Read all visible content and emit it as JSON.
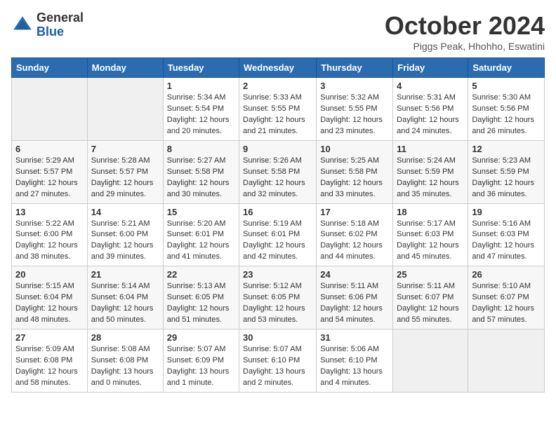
{
  "header": {
    "logo_general": "General",
    "logo_blue": "Blue",
    "month_title": "October 2024",
    "location": "Piggs Peak, Hhohho, Eswatini"
  },
  "weekdays": [
    "Sunday",
    "Monday",
    "Tuesday",
    "Wednesday",
    "Thursday",
    "Friday",
    "Saturday"
  ],
  "weeks": [
    [
      {
        "day": "",
        "sunrise": "",
        "sunset": "",
        "daylight": ""
      },
      {
        "day": "",
        "sunrise": "",
        "sunset": "",
        "daylight": ""
      },
      {
        "day": "1",
        "sunrise": "Sunrise: 5:34 AM",
        "sunset": "Sunset: 5:54 PM",
        "daylight": "Daylight: 12 hours and 20 minutes."
      },
      {
        "day": "2",
        "sunrise": "Sunrise: 5:33 AM",
        "sunset": "Sunset: 5:55 PM",
        "daylight": "Daylight: 12 hours and 21 minutes."
      },
      {
        "day": "3",
        "sunrise": "Sunrise: 5:32 AM",
        "sunset": "Sunset: 5:55 PM",
        "daylight": "Daylight: 12 hours and 23 minutes."
      },
      {
        "day": "4",
        "sunrise": "Sunrise: 5:31 AM",
        "sunset": "Sunset: 5:56 PM",
        "daylight": "Daylight: 12 hours and 24 minutes."
      },
      {
        "day": "5",
        "sunrise": "Sunrise: 5:30 AM",
        "sunset": "Sunset: 5:56 PM",
        "daylight": "Daylight: 12 hours and 26 minutes."
      }
    ],
    [
      {
        "day": "6",
        "sunrise": "Sunrise: 5:29 AM",
        "sunset": "Sunset: 5:57 PM",
        "daylight": "Daylight: 12 hours and 27 minutes."
      },
      {
        "day": "7",
        "sunrise": "Sunrise: 5:28 AM",
        "sunset": "Sunset: 5:57 PM",
        "daylight": "Daylight: 12 hours and 29 minutes."
      },
      {
        "day": "8",
        "sunrise": "Sunrise: 5:27 AM",
        "sunset": "Sunset: 5:58 PM",
        "daylight": "Daylight: 12 hours and 30 minutes."
      },
      {
        "day": "9",
        "sunrise": "Sunrise: 5:26 AM",
        "sunset": "Sunset: 5:58 PM",
        "daylight": "Daylight: 12 hours and 32 minutes."
      },
      {
        "day": "10",
        "sunrise": "Sunrise: 5:25 AM",
        "sunset": "Sunset: 5:58 PM",
        "daylight": "Daylight: 12 hours and 33 minutes."
      },
      {
        "day": "11",
        "sunrise": "Sunrise: 5:24 AM",
        "sunset": "Sunset: 5:59 PM",
        "daylight": "Daylight: 12 hours and 35 minutes."
      },
      {
        "day": "12",
        "sunrise": "Sunrise: 5:23 AM",
        "sunset": "Sunset: 5:59 PM",
        "daylight": "Daylight: 12 hours and 36 minutes."
      }
    ],
    [
      {
        "day": "13",
        "sunrise": "Sunrise: 5:22 AM",
        "sunset": "Sunset: 6:00 PM",
        "daylight": "Daylight: 12 hours and 38 minutes."
      },
      {
        "day": "14",
        "sunrise": "Sunrise: 5:21 AM",
        "sunset": "Sunset: 6:00 PM",
        "daylight": "Daylight: 12 hours and 39 minutes."
      },
      {
        "day": "15",
        "sunrise": "Sunrise: 5:20 AM",
        "sunset": "Sunset: 6:01 PM",
        "daylight": "Daylight: 12 hours and 41 minutes."
      },
      {
        "day": "16",
        "sunrise": "Sunrise: 5:19 AM",
        "sunset": "Sunset: 6:01 PM",
        "daylight": "Daylight: 12 hours and 42 minutes."
      },
      {
        "day": "17",
        "sunrise": "Sunrise: 5:18 AM",
        "sunset": "Sunset: 6:02 PM",
        "daylight": "Daylight: 12 hours and 44 minutes."
      },
      {
        "day": "18",
        "sunrise": "Sunrise: 5:17 AM",
        "sunset": "Sunset: 6:03 PM",
        "daylight": "Daylight: 12 hours and 45 minutes."
      },
      {
        "day": "19",
        "sunrise": "Sunrise: 5:16 AM",
        "sunset": "Sunset: 6:03 PM",
        "daylight": "Daylight: 12 hours and 47 minutes."
      }
    ],
    [
      {
        "day": "20",
        "sunrise": "Sunrise: 5:15 AM",
        "sunset": "Sunset: 6:04 PM",
        "daylight": "Daylight: 12 hours and 48 minutes."
      },
      {
        "day": "21",
        "sunrise": "Sunrise: 5:14 AM",
        "sunset": "Sunset: 6:04 PM",
        "daylight": "Daylight: 12 hours and 50 minutes."
      },
      {
        "day": "22",
        "sunrise": "Sunrise: 5:13 AM",
        "sunset": "Sunset: 6:05 PM",
        "daylight": "Daylight: 12 hours and 51 minutes."
      },
      {
        "day": "23",
        "sunrise": "Sunrise: 5:12 AM",
        "sunset": "Sunset: 6:05 PM",
        "daylight": "Daylight: 12 hours and 53 minutes."
      },
      {
        "day": "24",
        "sunrise": "Sunrise: 5:11 AM",
        "sunset": "Sunset: 6:06 PM",
        "daylight": "Daylight: 12 hours and 54 minutes."
      },
      {
        "day": "25",
        "sunrise": "Sunrise: 5:11 AM",
        "sunset": "Sunset: 6:07 PM",
        "daylight": "Daylight: 12 hours and 55 minutes."
      },
      {
        "day": "26",
        "sunrise": "Sunrise: 5:10 AM",
        "sunset": "Sunset: 6:07 PM",
        "daylight": "Daylight: 12 hours and 57 minutes."
      }
    ],
    [
      {
        "day": "27",
        "sunrise": "Sunrise: 5:09 AM",
        "sunset": "Sunset: 6:08 PM",
        "daylight": "Daylight: 12 hours and 58 minutes."
      },
      {
        "day": "28",
        "sunrise": "Sunrise: 5:08 AM",
        "sunset": "Sunset: 6:08 PM",
        "daylight": "Daylight: 13 hours and 0 minutes."
      },
      {
        "day": "29",
        "sunrise": "Sunrise: 5:07 AM",
        "sunset": "Sunset: 6:09 PM",
        "daylight": "Daylight: 13 hours and 1 minute."
      },
      {
        "day": "30",
        "sunrise": "Sunrise: 5:07 AM",
        "sunset": "Sunset: 6:10 PM",
        "daylight": "Daylight: 13 hours and 2 minutes."
      },
      {
        "day": "31",
        "sunrise": "Sunrise: 5:06 AM",
        "sunset": "Sunset: 6:10 PM",
        "daylight": "Daylight: 13 hours and 4 minutes."
      },
      {
        "day": "",
        "sunrise": "",
        "sunset": "",
        "daylight": ""
      },
      {
        "day": "",
        "sunrise": "",
        "sunset": "",
        "daylight": ""
      }
    ]
  ]
}
